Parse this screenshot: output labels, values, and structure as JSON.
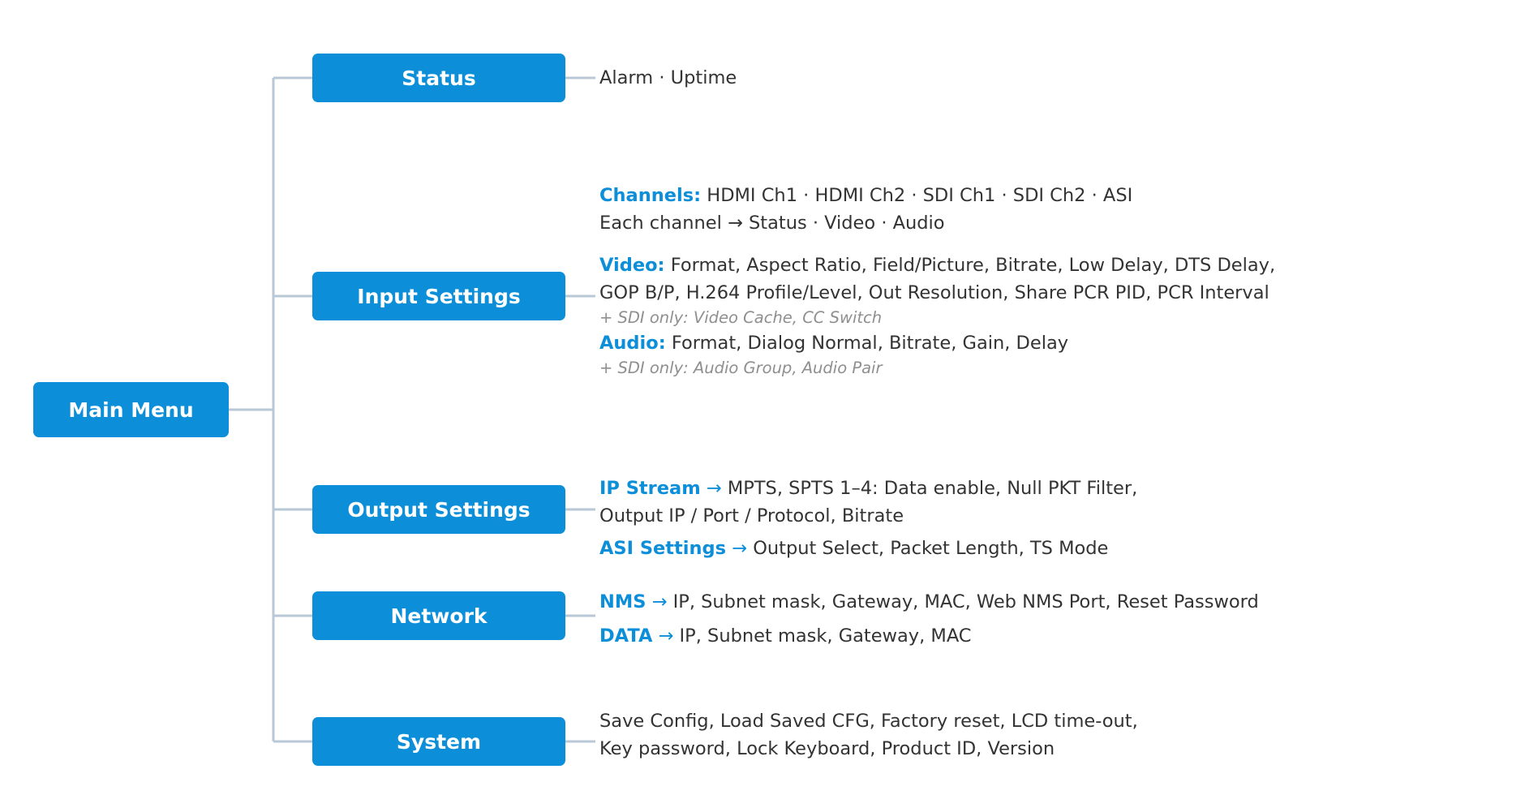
{
  "root": {
    "label": "Main Menu"
  },
  "colors": {
    "accent": "#0c8fd8",
    "connector": "#b9c8d6",
    "text": "#333333",
    "note": "#8f8f8f"
  },
  "branches": {
    "status": {
      "label": "Status",
      "line1": "Alarm · Uptime"
    },
    "input": {
      "label": "Input Settings",
      "channels_kw": "Channels:",
      "channels_text": " HDMI Ch1 · HDMI Ch2 · SDI Ch1 · SDI Ch2 · ASI",
      "each_channel": "Each channel → Status · Video · Audio",
      "video_kw": "Video:",
      "video_text": " Format, Aspect Ratio, Field/Picture, Bitrate, Low Delay, DTS Delay,",
      "video_text2": "GOP B/P, H.264 Profile/Level, Out Resolution, Share PCR PID, PCR Interval",
      "video_note": "+ SDI only: Video Cache, CC Switch",
      "audio_kw": "Audio:",
      "audio_text": " Format, Dialog Normal, Bitrate, Gain, Delay",
      "audio_note": "+ SDI only: Audio Group, Audio Pair"
    },
    "output": {
      "label": "Output Settings",
      "ip_kw": "IP Stream",
      "arrow": " → ",
      "ip_text": "MPTS, SPTS 1–4: Data enable, Null PKT Filter,",
      "ip_text2": "Output IP / Port / Protocol, Bitrate",
      "asi_kw": "ASI Settings",
      "asi_text": "Output Select, Packet Length, TS Mode"
    },
    "network": {
      "label": "Network",
      "nms_kw": "NMS",
      "arrow": " → ",
      "nms_text": "IP, Subnet mask, Gateway, MAC, Web NMS Port, Reset Password",
      "data_kw": "DATA",
      "data_text": "IP, Subnet mask, Gateway, MAC"
    },
    "system": {
      "label": "System",
      "line1": "Save Config, Load Saved CFG, Factory reset, LCD time-out,",
      "line2": "Key password, Lock Keyboard, Product ID, Version"
    }
  }
}
